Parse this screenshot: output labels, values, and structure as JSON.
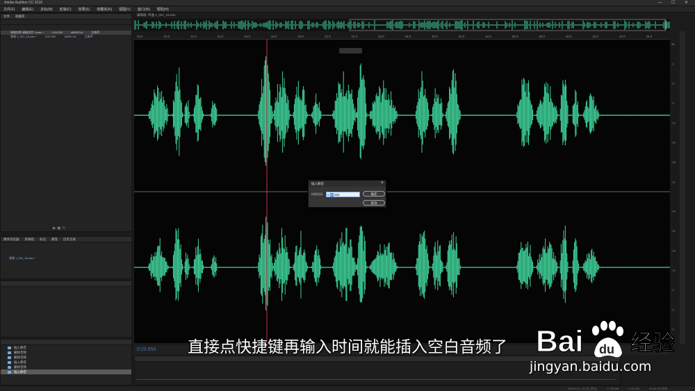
{
  "app": {
    "title": "Adobe Audition CC 2018",
    "window_controls": "— ☐ ✕"
  },
  "menu": [
    "文件(F)",
    "编辑(E)",
    "多轨(M)",
    "剪辑(C)",
    "效果(S)",
    "收藏夹(R)",
    "视图(V)",
    "窗口(W)",
    "帮助(H)"
  ],
  "files_panel": {
    "tabs": [
      "文件",
      "收藏夹"
    ],
    "files": [
      {
        "name": "单曲名称 录制文件 1.wav *",
        "time": "0:49.200",
        "rate": "48000 Hz",
        "ch": "立体声",
        "selected": true
      },
      {
        "name": "我课 1_001_16.wav *",
        "time": "0:00.000",
        "rate": "48000 Hz",
        "ch": "立体声",
        "selected": false
      }
    ]
  },
  "media_panel": {
    "tabs": [
      "媒体浏览器",
      "效果组",
      "标记",
      "属性",
      "历史记录"
    ],
    "item": "我课 1_001_16.wav *"
  },
  "history": {
    "items": [
      "插入静音",
      "删除音频",
      "删除音频",
      "插入静音",
      "删除音频",
      "插入静音"
    ]
  },
  "editor": {
    "tab": "编辑器: 单曲 1_001_16.wav",
    "timecode": "0:23.650",
    "ruler": [
      "hms",
      "10.0",
      "12.0",
      "14.0",
      "16.0",
      "18.0",
      "20.0",
      "22.0",
      "24.0",
      "26.0",
      "28.0",
      "30.0",
      "32.0",
      "34.0",
      "36.0",
      "38.0",
      "40.0",
      "42.0",
      "44.0",
      "46.0"
    ],
    "db_labels": [
      "dB",
      "-3",
      "-6",
      "-9",
      "-12",
      "-15",
      "-18",
      "-21",
      "-24",
      "-21",
      "-15",
      "-12",
      "-9",
      "-6",
      "-3"
    ]
  },
  "dialog": {
    "title": "插入静音",
    "label": "持续时间:",
    "value": "0:",
    "value_selected": "10",
    "value_rest": ".000",
    "ok": "确定",
    "cancel": "取消"
  },
  "status": {
    "left": "48000 Hz • 32 位 (浮点)",
    "size": "17.65 MB",
    "dur": "0:49.200",
    "free": "44.89 GB 空闲"
  },
  "subtitle": "直接点快捷键再输入时间就能插入空白音频了",
  "watermark": {
    "brand": "Bai",
    "brand2": "du",
    "cn": "经验",
    "url": "jingyan.baidu.com"
  },
  "colors": {
    "wave": "#3fd39a",
    "playhead": "#c8324a",
    "accent": "#3a7ad8"
  }
}
